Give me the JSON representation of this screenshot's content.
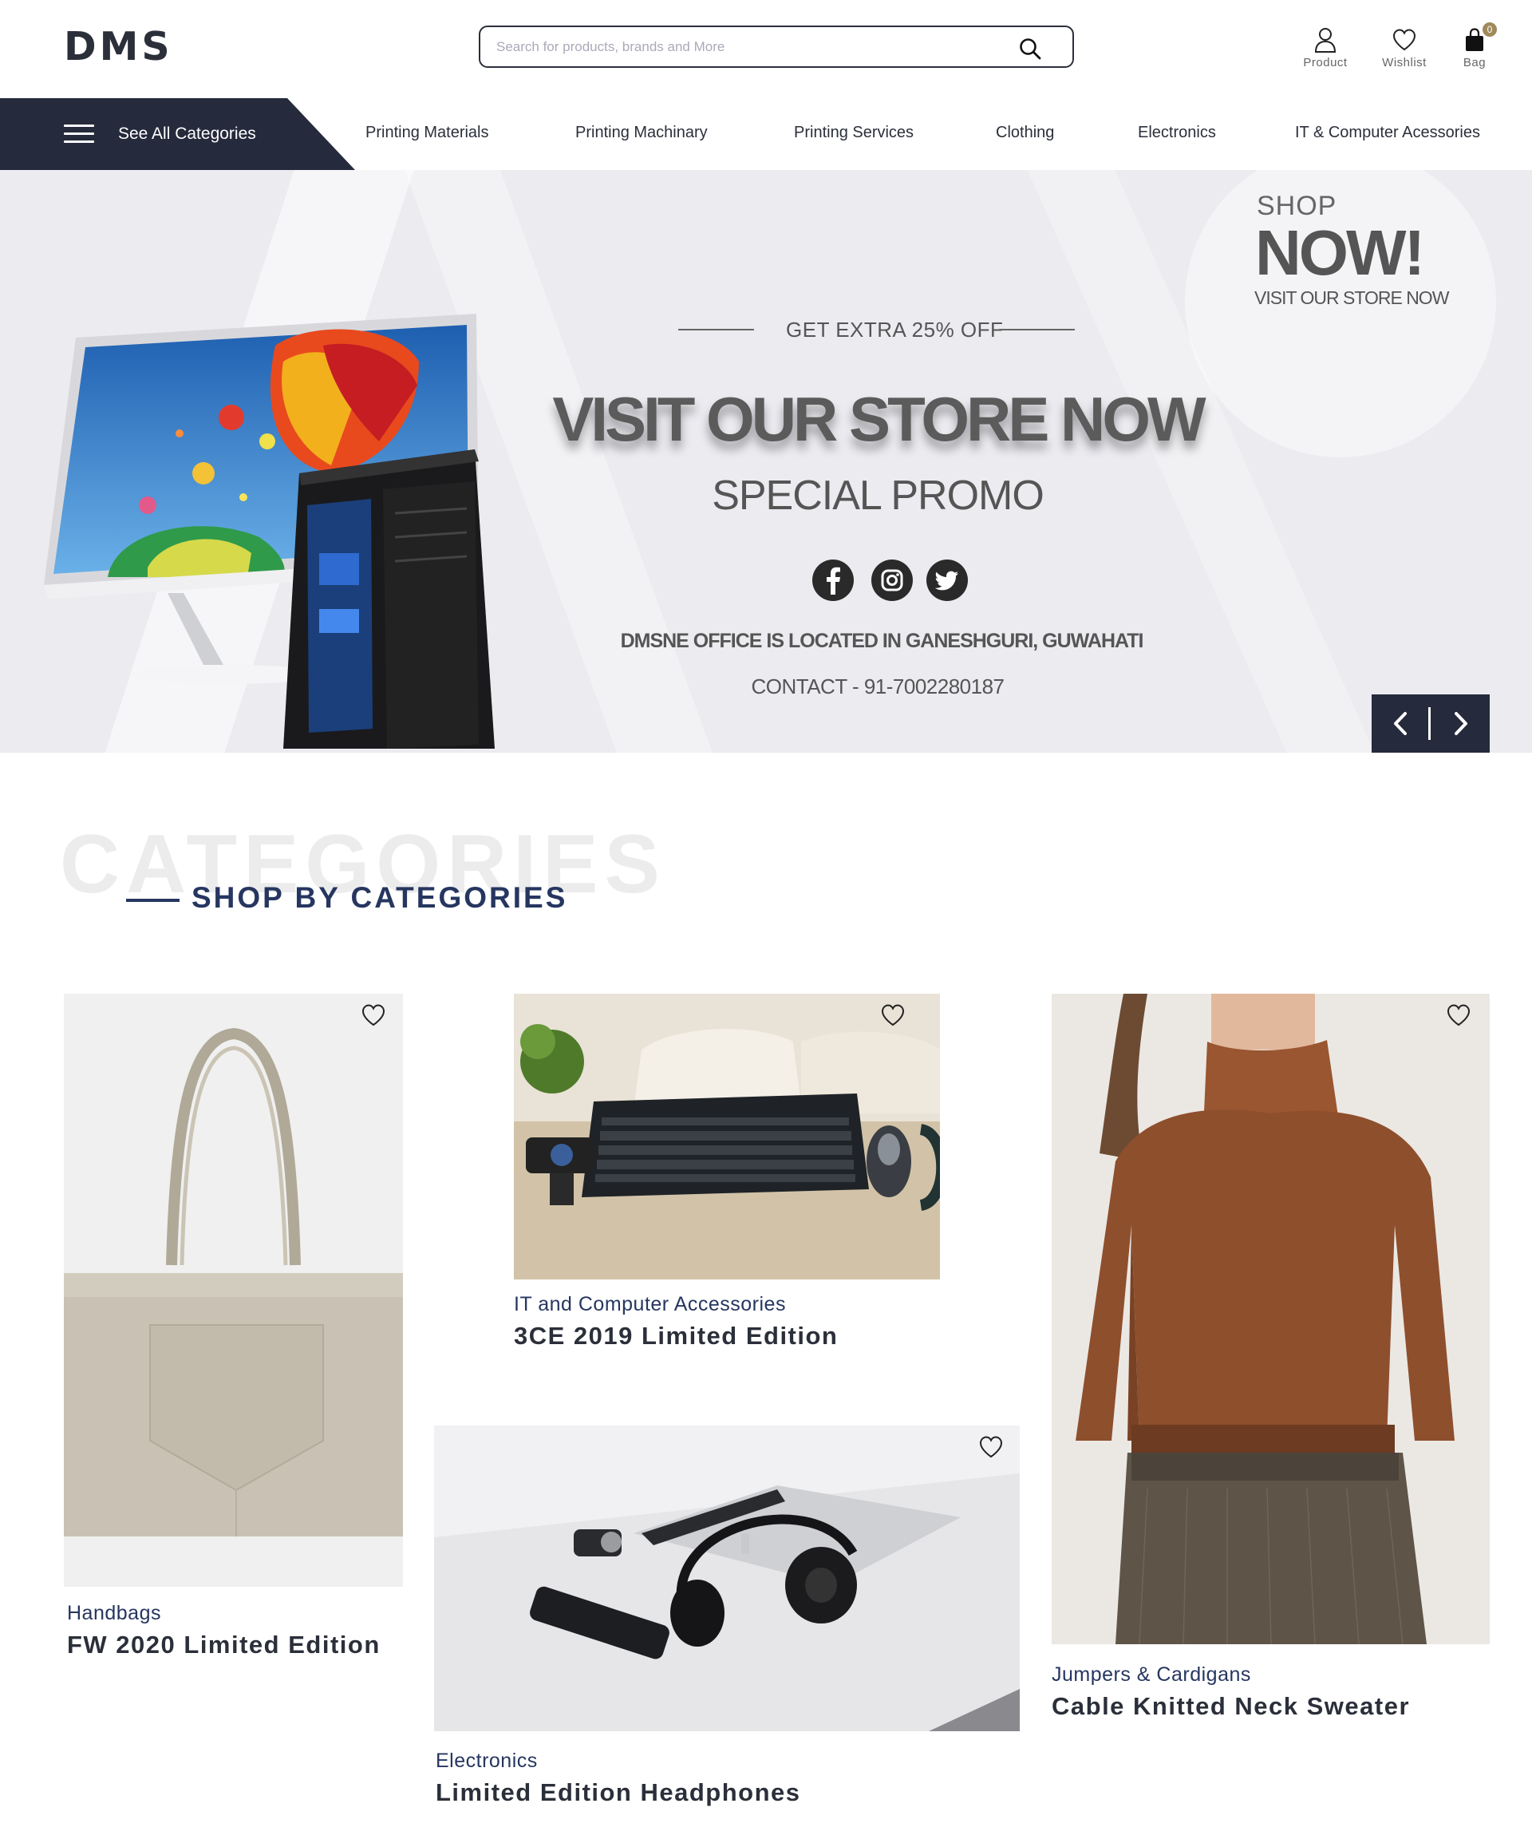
{
  "header": {
    "logo": "DMS",
    "search_placeholder": "Search for products, brands and More",
    "icons": {
      "product_label": "Product",
      "wishlist_label": "Wishlist",
      "bag_label": "Bag",
      "bag_count": "0"
    }
  },
  "nav": {
    "all_categories": "See All Categories",
    "links": [
      "Printing Materials",
      "Printing Machinary",
      "Printing Services",
      "Clothing",
      "Electronics",
      "IT & Computer Acessories"
    ]
  },
  "hero": {
    "shop": "SHOP",
    "now": "NOW!",
    "visit_small": "VISIT OUR STORE NOW",
    "offer": "GET EXTRA 25% OFF",
    "headline": "VISIT OUR STORE NOW",
    "promo": "SPECIAL PROMO",
    "socials": [
      "facebook-icon",
      "instagram-icon",
      "twitter-icon"
    ],
    "office": "DMSNE OFFICE IS LOCATED IN GANESHGURI, GUWAHATI",
    "contact": "CONTACT - 91-7002280187"
  },
  "categories": {
    "bg_text": "CATEGORIES",
    "title": "SHOP BY CATEGORIES",
    "cards": [
      {
        "category": "Handbags",
        "product": "FW 2020 Limited Edition"
      },
      {
        "category": "IT and Computer Accessories",
        "product": "3CE 2019 Limited Edition"
      },
      {
        "category": "Electronics",
        "product": "Limited Edition Headphones"
      },
      {
        "category": "Jumpers & Cardigans",
        "product": "Cable Knitted Neck Sweater"
      }
    ]
  },
  "colors": {
    "navy": "#252a3c",
    "accent_blue": "#263660",
    "badge_gold": "#a0895a",
    "hero_bg": "#ebebf0"
  }
}
